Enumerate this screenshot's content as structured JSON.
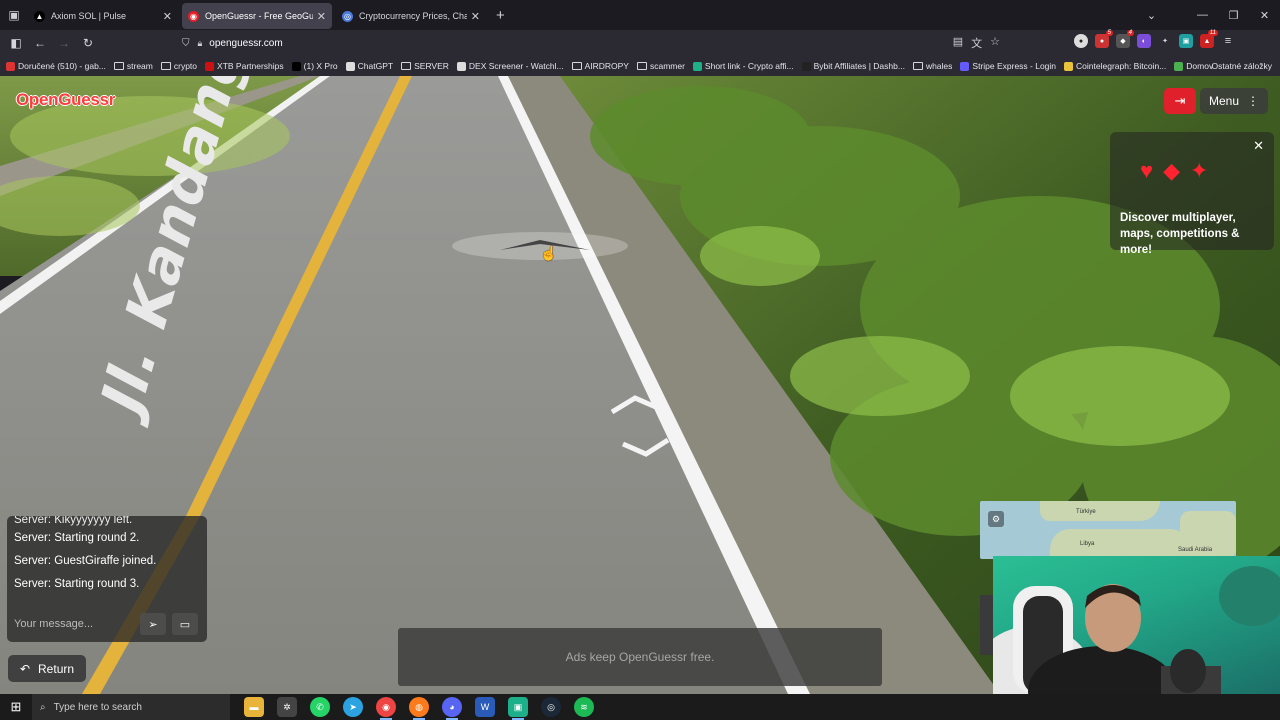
{
  "browser": {
    "tabs": [
      {
        "title": "Axiom SOL | Pulse",
        "active": false,
        "icon": "axiom-icon"
      },
      {
        "title": "OpenGuessr - Free GeoGue",
        "active": true,
        "icon": "openguessr-icon"
      },
      {
        "title": "Cryptocurrency Prices, Charts A",
        "active": false,
        "icon": "coingecko-icon"
      }
    ],
    "url": "openguessr.com",
    "bookmarks": [
      {
        "label": "Doručené (510) - gab...",
        "icon": "gmail-icon"
      },
      {
        "label": "stream",
        "icon": "folder-icon"
      },
      {
        "label": "crypto",
        "icon": "folder-icon"
      },
      {
        "label": "XTB Partnerships",
        "icon": "xtb-icon"
      },
      {
        "label": "(1) X Pro",
        "icon": "x-icon"
      },
      {
        "label": "ChatGPT",
        "icon": "chatgpt-icon"
      },
      {
        "label": "SERVER",
        "icon": "folder-icon"
      },
      {
        "label": "DEX Screener - Watchl...",
        "icon": "dexscreener-icon"
      },
      {
        "label": "AIRDROPY",
        "icon": "folder-icon"
      },
      {
        "label": "scammer",
        "icon": "folder-icon"
      },
      {
        "label": "Short link - Crypto affi...",
        "icon": "link-icon"
      },
      {
        "label": "Bybit Affiliates | Dashb...",
        "icon": "bybit-icon"
      },
      {
        "label": "whales",
        "icon": "folder-icon"
      },
      {
        "label": "Stripe Express - Login",
        "icon": "stripe-icon"
      },
      {
        "label": "Cointelegraph: Bitcoin...",
        "icon": "cointelegraph-icon"
      },
      {
        "label": "Domov",
        "icon": "home-icon"
      }
    ],
    "other_bookmarks": "Ostatné záložky"
  },
  "game": {
    "logo": "OpenGuessr",
    "road_text": "Jl. Kandangan - Balikpapan",
    "menu_label": "Menu",
    "promo_text": "Discover multiplayer, maps, competitions & more!",
    "chat": {
      "messages": [
        "Server: Kikyyyyyyy left.",
        "Server: Starting round 2.",
        "Server: GuestGiraffe joined.",
        "Server: Starting round 3."
      ],
      "placeholder": "Your message..."
    },
    "return_label": "Return",
    "ads_text": "Ads keep OpenGuessr free.",
    "minimap_labels": [
      "Türkiye",
      "Libya",
      "Saudi Arabia"
    ]
  },
  "taskbar": {
    "search_placeholder": "Type here to search",
    "apps": [
      "file-explorer-icon",
      "app-icon",
      "whatsapp-icon",
      "telegram-icon",
      "chrome-icon",
      "firefox-icon",
      "discord-icon",
      "word-icon",
      "app2-icon",
      "steam-icon",
      "spotify-icon"
    ]
  },
  "colors": {
    "brand_red": "#e0202a",
    "road": "#8f8f8f",
    "yellow_line": "#e3b33c",
    "grass": "#6d8a3b"
  }
}
